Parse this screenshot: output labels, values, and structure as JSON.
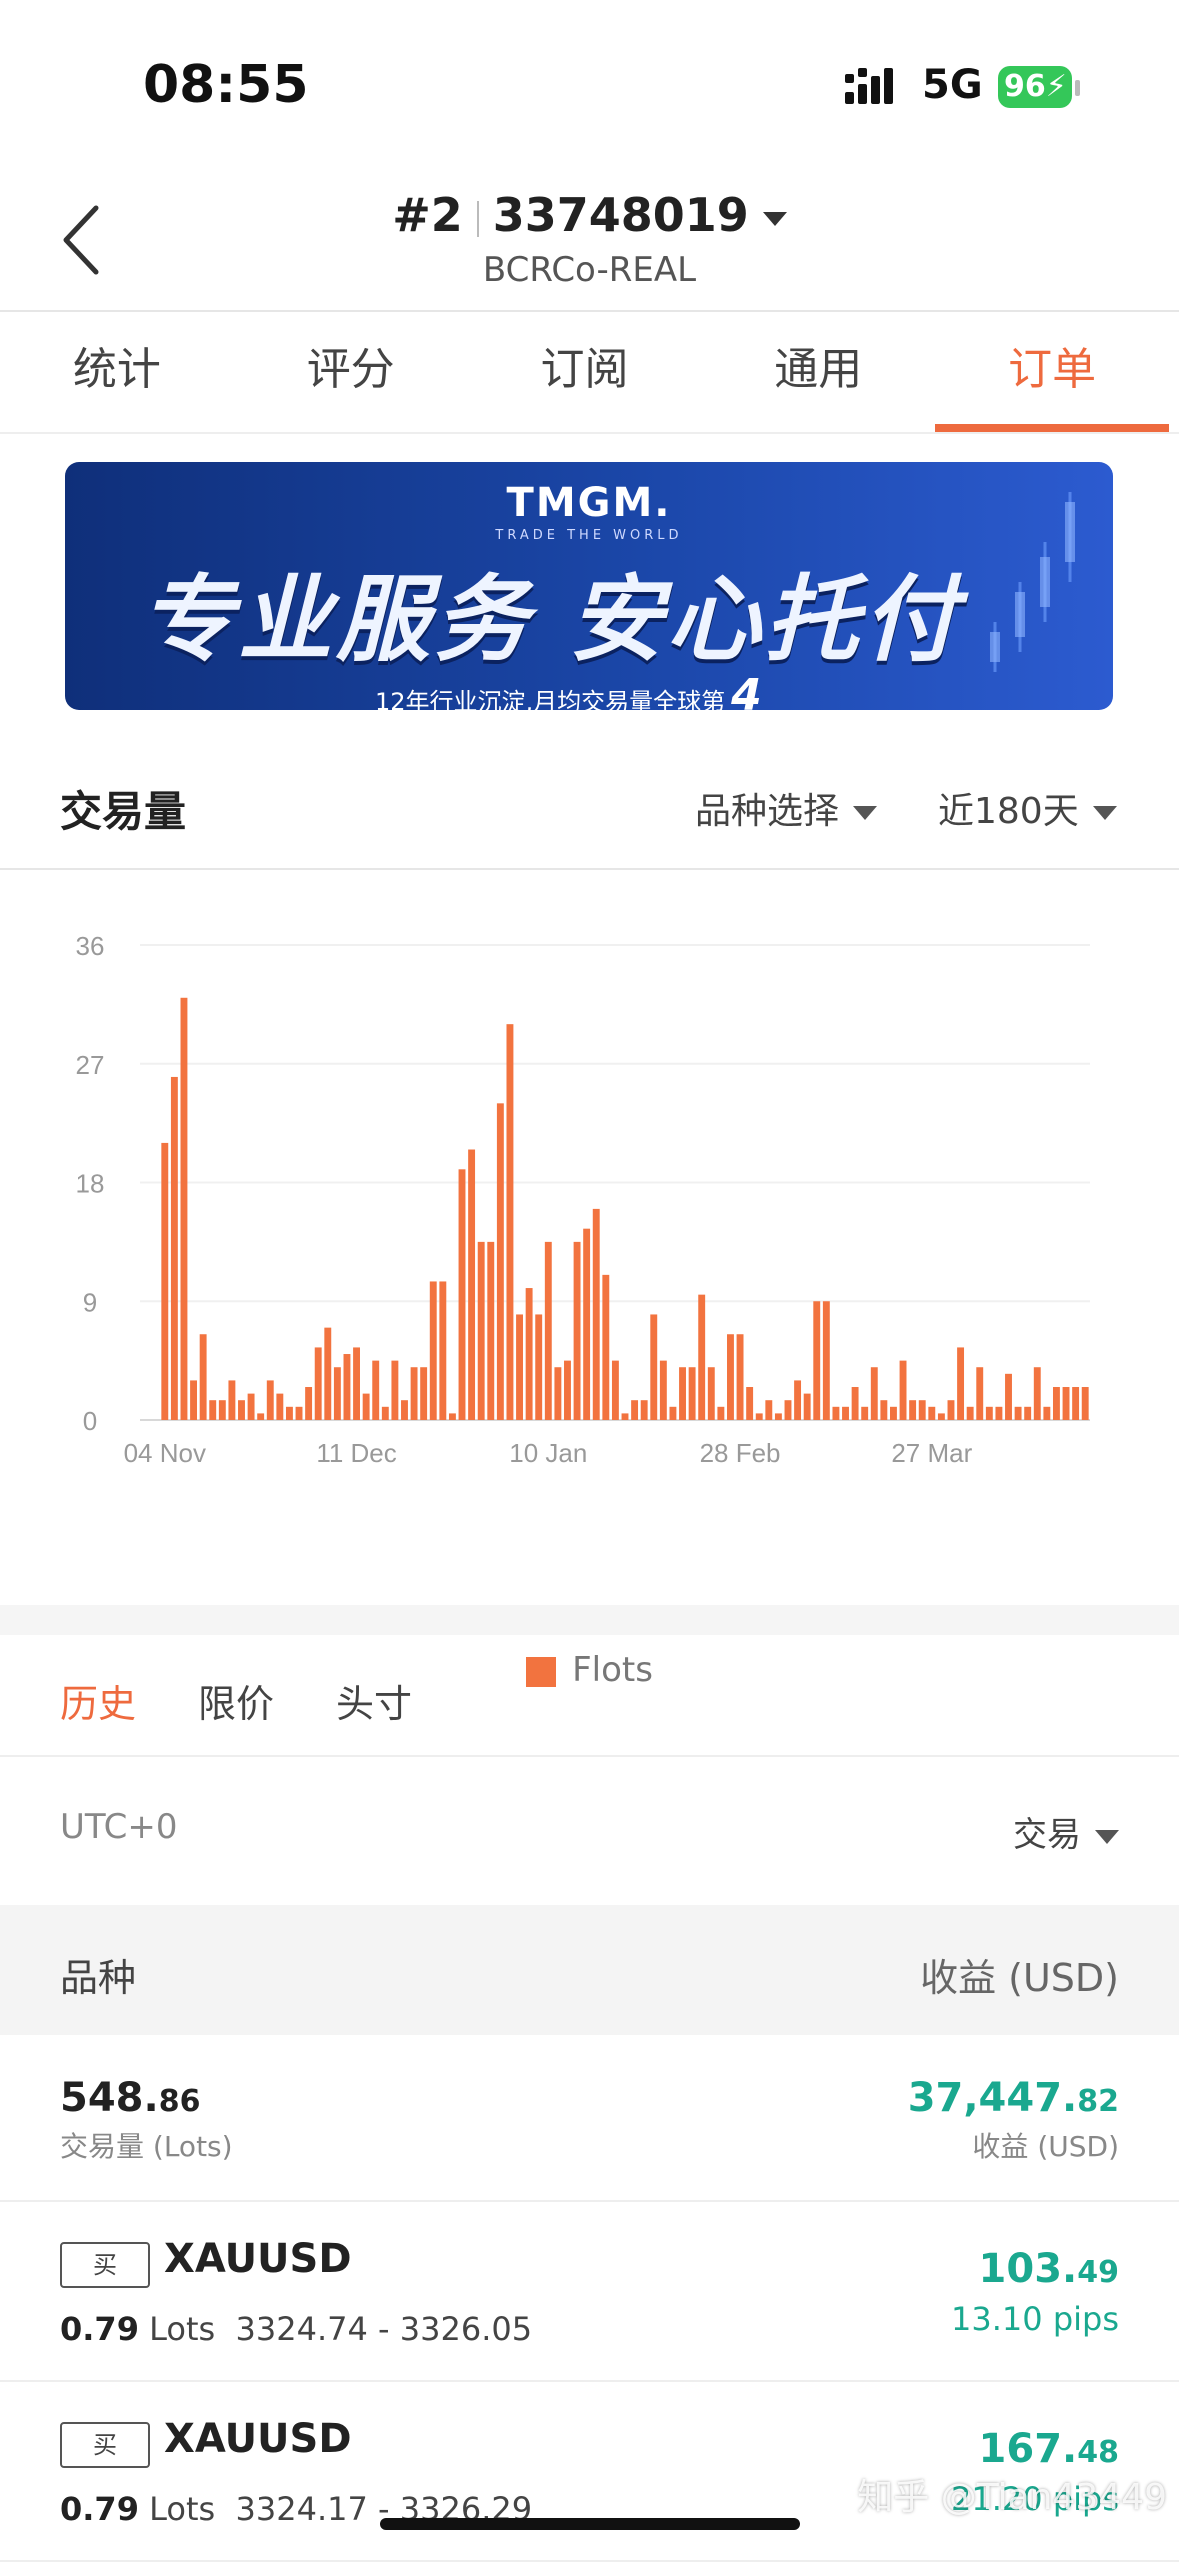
{
  "status": {
    "time": "08:55",
    "network": "5G",
    "battery": "96"
  },
  "header": {
    "rank": "#2",
    "account": "33748019",
    "server": "BCRCo-REAL"
  },
  "tabs": [
    {
      "label": "统计"
    },
    {
      "label": "评分"
    },
    {
      "label": "订阅"
    },
    {
      "label": "通用"
    },
    {
      "label": "订单",
      "active": true
    }
  ],
  "banner": {
    "brand": "TMGM.",
    "tagline": "TRADE THE WORLD",
    "headline": "专业服务 安心托付",
    "footer": "12年行业沉淀,月均交易量全球第",
    "rank_number": "4"
  },
  "volume": {
    "title": "交易量",
    "filter_symbol": "品种选择",
    "filter_period": "近180天"
  },
  "chart_data": {
    "type": "bar",
    "ylim": [
      0,
      36
    ],
    "yticks": [
      0,
      9,
      18,
      27,
      36
    ],
    "xtick_labels": [
      "04 Nov",
      "11 Dec",
      "10 Jan",
      "28 Feb",
      "27 Mar"
    ],
    "xtick_index": [
      0,
      20,
      40,
      60,
      80
    ],
    "legend": [
      "Flots"
    ],
    "color": "#f2733f",
    "series": [
      {
        "name": "Flots",
        "values": [
          21,
          26,
          32,
          3,
          6.5,
          1.5,
          1.5,
          3,
          1.5,
          2,
          0.5,
          3,
          2,
          1,
          1,
          2.5,
          5.5,
          7,
          4,
          5,
          5.5,
          2,
          4.5,
          1,
          4.5,
          1.5,
          4,
          4,
          10.5,
          10.5,
          0.5,
          19,
          20.5,
          13.5,
          13.5,
          24,
          30,
          8,
          10,
          8,
          13.5,
          4,
          4.5,
          13.5,
          14.5,
          16,
          11,
          4.5,
          0.5,
          1.5,
          1.5,
          8,
          4.5,
          1,
          4,
          4,
          9.5,
          4,
          1,
          6.5,
          6.5,
          2.5,
          0.5,
          1.5,
          0.5,
          1.5,
          3,
          2,
          9,
          9,
          1,
          1,
          2.5,
          1,
          4,
          1.5,
          1,
          4.5,
          1.5,
          1.5,
          1,
          0.5,
          1.5,
          5.5,
          1,
          4,
          1,
          1,
          3.5,
          1,
          1,
          4,
          1,
          2.5,
          2.5,
          2.5,
          2.5
        ]
      }
    ]
  },
  "history": {
    "tabs": [
      {
        "label": "历史",
        "active": true
      },
      {
        "label": "限价"
      },
      {
        "label": "头寸"
      }
    ],
    "timezone": "UTC+0",
    "filter": "交易"
  },
  "table": {
    "col_left": "品种",
    "col_right": "收益 (USD)",
    "summary": {
      "volume_int": "548.",
      "volume_frac": "86",
      "volume_label": "交易量 (Lots)",
      "profit_int": "37,447.",
      "profit_frac": "82",
      "profit_label": "收益 (USD)"
    },
    "orders": [
      {
        "side": "买",
        "symbol": "XAUUSD",
        "lots": "0.79",
        "lots_unit": "Lots",
        "range": "3324.74 - 3326.05",
        "profit_int": "103.",
        "profit_frac": "49",
        "pips": "13.10 pips"
      },
      {
        "side": "买",
        "symbol": "XAUUSD",
        "lots": "0.79",
        "lots_unit": "Lots",
        "range": "3324.17 - 3326.29",
        "profit_int": "167.",
        "profit_frac": "48",
        "pips": "21.20 pips"
      }
    ]
  },
  "watermark": "知乎 @Tian43449"
}
